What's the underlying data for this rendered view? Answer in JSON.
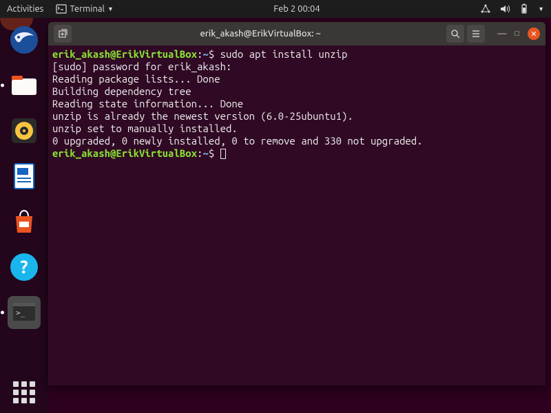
{
  "topbar": {
    "activities": "Activities",
    "app_menu": "Terminal",
    "datetime": "Feb 2  00:04"
  },
  "window": {
    "title": "erik_akash@ErikVirtualBox: ~"
  },
  "terminal": {
    "prompt_user": "erik_akash@ErikVirtualBox",
    "prompt_path": "~",
    "prompt_sep": ":",
    "prompt_dollar": "$",
    "cmd1": " sudo apt install unzip",
    "l1": "[sudo] password for erik_akash:",
    "l2": "Reading package lists... Done",
    "l3": "Building dependency tree",
    "l4": "Reading state information... Done",
    "l5": "unzip is already the newest version (6.0-25ubuntu1).",
    "l6": "unzip set to manually installed.",
    "l7": "0 upgraded, 0 newly installed, 0 to remove and 330 not upgraded."
  },
  "icons": {
    "new_tab": "⧉",
    "search": "🔍",
    "menu": "≡",
    "min": "—",
    "max": "□",
    "close": "✕"
  }
}
